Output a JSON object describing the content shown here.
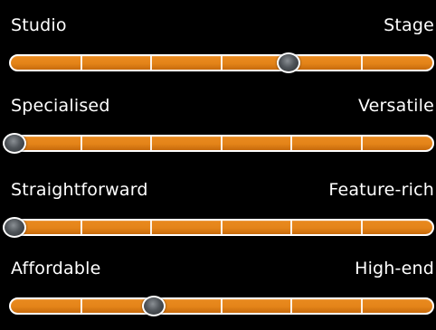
{
  "sliders": [
    {
      "left_label": "Studio",
      "right_label": "Stage",
      "value": 0.67
    },
    {
      "left_label": "Specialised",
      "right_label": "Versatile",
      "value": 0.0
    },
    {
      "left_label": "Straightforward",
      "right_label": "Feature-rich",
      "value": 0.0
    },
    {
      "left_label": "Affordable",
      "right_label": "High-end",
      "value": 0.34
    }
  ],
  "segments": 6,
  "colors": {
    "track": "#e48419",
    "track_border": "#ffffff",
    "thumb": "#50555a",
    "background": "#000000",
    "text": "#ffffff"
  }
}
